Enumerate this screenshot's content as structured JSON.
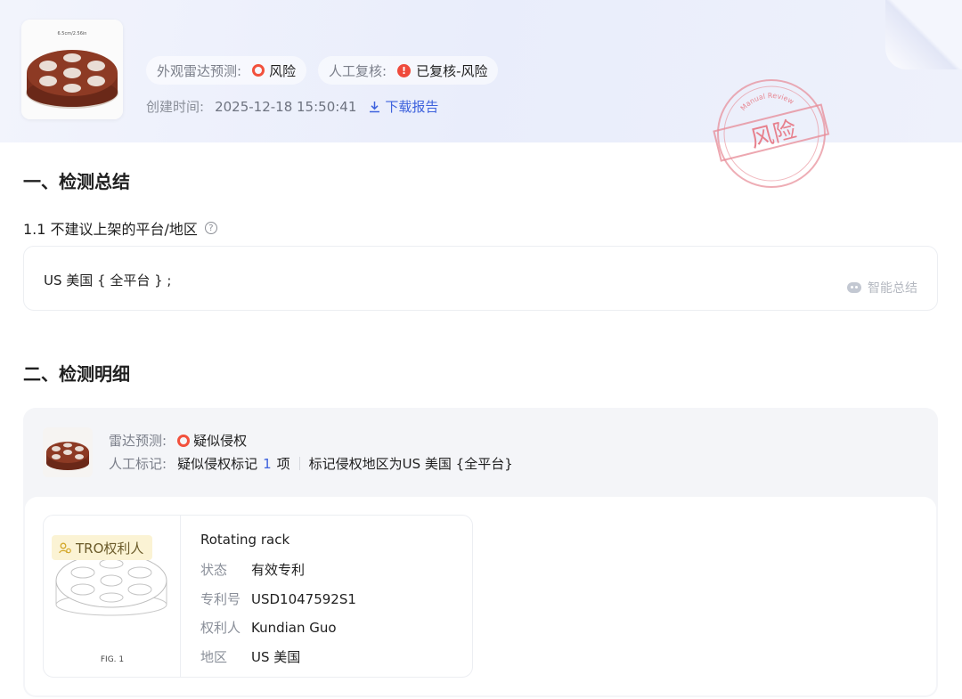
{
  "header": {
    "thumb_caption": "6.5cm/2.56in",
    "radar": {
      "label": "外观雷达预测:",
      "value": "风险"
    },
    "manual": {
      "label": "人工复核:",
      "value": "已复核-风险"
    },
    "created_label": "创建时间:",
    "created_time": "2025-12-18 15:50:41",
    "download_label": "下载报告",
    "stamp": {
      "arc_text": "Manual Review",
      "text": "风险"
    }
  },
  "section1": {
    "title": "一、检测总结",
    "subtitle": "1.1 不建议上架的平台/地区",
    "summary": "US 美国 { 全平台 } ;",
    "smart_summary": "智能总结"
  },
  "section2": {
    "title": "二、检测明细",
    "radar_label": "雷达预测:",
    "radar_value": "疑似侵权",
    "manual_label": "人工标记:",
    "manual_prefix": "疑似侵权标记",
    "manual_count": "1",
    "manual_suffix": "项",
    "region_note": "标记侵权地区为US 美国 {全平台}"
  },
  "patent": {
    "badge": "TRO权利人",
    "fig": "FIG. 1",
    "title": "Rotating rack",
    "status_label": "状态",
    "status": "有效专利",
    "number_label": "专利号",
    "number": "USD1047592S1",
    "owner_label": "权利人",
    "owner": "Kundian Guo",
    "region_label": "地区",
    "region": "US 美国"
  },
  "colors": {
    "accent": "#3e62dd",
    "risk": "#f2513d",
    "stamp": "#e78a95",
    "header_bg": "#eceffb"
  }
}
